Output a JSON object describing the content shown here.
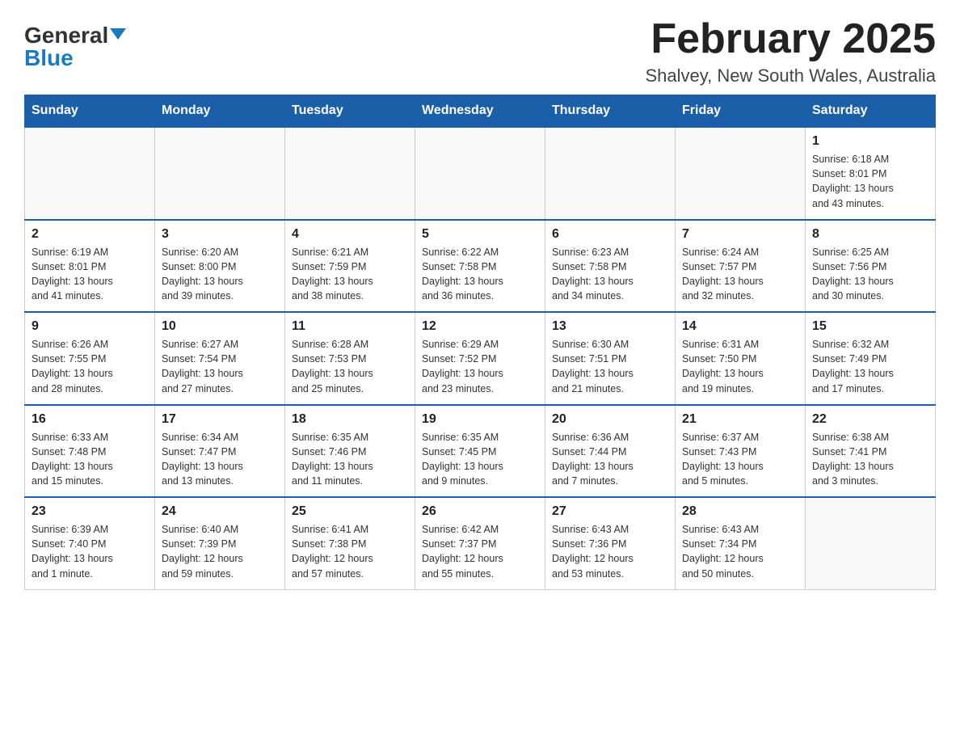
{
  "header": {
    "logo_main": "General",
    "logo_accent": "Blue",
    "main_title": "February 2025",
    "subtitle": "Shalvey, New South Wales, Australia"
  },
  "weekdays": [
    "Sunday",
    "Monday",
    "Tuesday",
    "Wednesday",
    "Thursday",
    "Friday",
    "Saturday"
  ],
  "weeks": [
    [
      {
        "day": "",
        "info": ""
      },
      {
        "day": "",
        "info": ""
      },
      {
        "day": "",
        "info": ""
      },
      {
        "day": "",
        "info": ""
      },
      {
        "day": "",
        "info": ""
      },
      {
        "day": "",
        "info": ""
      },
      {
        "day": "1",
        "info": "Sunrise: 6:18 AM\nSunset: 8:01 PM\nDaylight: 13 hours\nand 43 minutes."
      }
    ],
    [
      {
        "day": "2",
        "info": "Sunrise: 6:19 AM\nSunset: 8:01 PM\nDaylight: 13 hours\nand 41 minutes."
      },
      {
        "day": "3",
        "info": "Sunrise: 6:20 AM\nSunset: 8:00 PM\nDaylight: 13 hours\nand 39 minutes."
      },
      {
        "day": "4",
        "info": "Sunrise: 6:21 AM\nSunset: 7:59 PM\nDaylight: 13 hours\nand 38 minutes."
      },
      {
        "day": "5",
        "info": "Sunrise: 6:22 AM\nSunset: 7:58 PM\nDaylight: 13 hours\nand 36 minutes."
      },
      {
        "day": "6",
        "info": "Sunrise: 6:23 AM\nSunset: 7:58 PM\nDaylight: 13 hours\nand 34 minutes."
      },
      {
        "day": "7",
        "info": "Sunrise: 6:24 AM\nSunset: 7:57 PM\nDaylight: 13 hours\nand 32 minutes."
      },
      {
        "day": "8",
        "info": "Sunrise: 6:25 AM\nSunset: 7:56 PM\nDaylight: 13 hours\nand 30 minutes."
      }
    ],
    [
      {
        "day": "9",
        "info": "Sunrise: 6:26 AM\nSunset: 7:55 PM\nDaylight: 13 hours\nand 28 minutes."
      },
      {
        "day": "10",
        "info": "Sunrise: 6:27 AM\nSunset: 7:54 PM\nDaylight: 13 hours\nand 27 minutes."
      },
      {
        "day": "11",
        "info": "Sunrise: 6:28 AM\nSunset: 7:53 PM\nDaylight: 13 hours\nand 25 minutes."
      },
      {
        "day": "12",
        "info": "Sunrise: 6:29 AM\nSunset: 7:52 PM\nDaylight: 13 hours\nand 23 minutes."
      },
      {
        "day": "13",
        "info": "Sunrise: 6:30 AM\nSunset: 7:51 PM\nDaylight: 13 hours\nand 21 minutes."
      },
      {
        "day": "14",
        "info": "Sunrise: 6:31 AM\nSunset: 7:50 PM\nDaylight: 13 hours\nand 19 minutes."
      },
      {
        "day": "15",
        "info": "Sunrise: 6:32 AM\nSunset: 7:49 PM\nDaylight: 13 hours\nand 17 minutes."
      }
    ],
    [
      {
        "day": "16",
        "info": "Sunrise: 6:33 AM\nSunset: 7:48 PM\nDaylight: 13 hours\nand 15 minutes."
      },
      {
        "day": "17",
        "info": "Sunrise: 6:34 AM\nSunset: 7:47 PM\nDaylight: 13 hours\nand 13 minutes."
      },
      {
        "day": "18",
        "info": "Sunrise: 6:35 AM\nSunset: 7:46 PM\nDaylight: 13 hours\nand 11 minutes."
      },
      {
        "day": "19",
        "info": "Sunrise: 6:35 AM\nSunset: 7:45 PM\nDaylight: 13 hours\nand 9 minutes."
      },
      {
        "day": "20",
        "info": "Sunrise: 6:36 AM\nSunset: 7:44 PM\nDaylight: 13 hours\nand 7 minutes."
      },
      {
        "day": "21",
        "info": "Sunrise: 6:37 AM\nSunset: 7:43 PM\nDaylight: 13 hours\nand 5 minutes."
      },
      {
        "day": "22",
        "info": "Sunrise: 6:38 AM\nSunset: 7:41 PM\nDaylight: 13 hours\nand 3 minutes."
      }
    ],
    [
      {
        "day": "23",
        "info": "Sunrise: 6:39 AM\nSunset: 7:40 PM\nDaylight: 13 hours\nand 1 minute."
      },
      {
        "day": "24",
        "info": "Sunrise: 6:40 AM\nSunset: 7:39 PM\nDaylight: 12 hours\nand 59 minutes."
      },
      {
        "day": "25",
        "info": "Sunrise: 6:41 AM\nSunset: 7:38 PM\nDaylight: 12 hours\nand 57 minutes."
      },
      {
        "day": "26",
        "info": "Sunrise: 6:42 AM\nSunset: 7:37 PM\nDaylight: 12 hours\nand 55 minutes."
      },
      {
        "day": "27",
        "info": "Sunrise: 6:43 AM\nSunset: 7:36 PM\nDaylight: 12 hours\nand 53 minutes."
      },
      {
        "day": "28",
        "info": "Sunrise: 6:43 AM\nSunset: 7:34 PM\nDaylight: 12 hours\nand 50 minutes."
      },
      {
        "day": "",
        "info": ""
      }
    ]
  ]
}
